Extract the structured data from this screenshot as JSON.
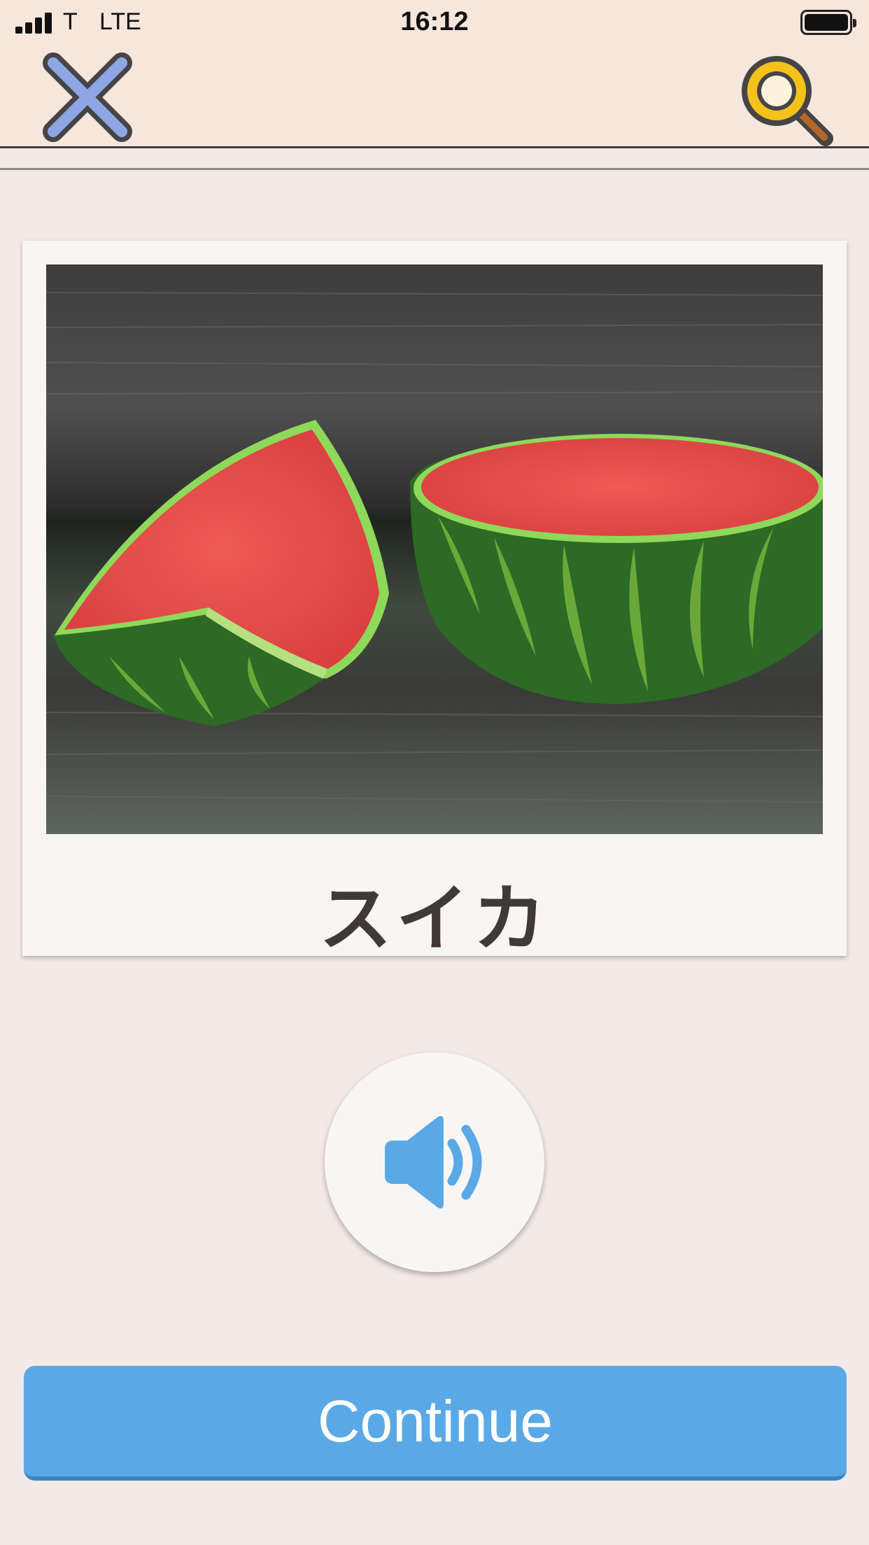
{
  "status_bar": {
    "carrier": "T",
    "network": "LTE",
    "time": "16:12"
  },
  "icons": {
    "close": "close-icon",
    "search": "search-icon",
    "speaker": "speaker-icon"
  },
  "colors": {
    "close_icon_fill": "#8fa6e6",
    "search_icon_ring": "#f5c21b",
    "search_icon_handle": "#b8672a",
    "speaker": "#5aa9e6",
    "continue_button": "#5aa9e6",
    "background": "#f3e9e6"
  },
  "card": {
    "image": "watermelon-photo",
    "word": "スイカ"
  },
  "continue_label": "Continue"
}
